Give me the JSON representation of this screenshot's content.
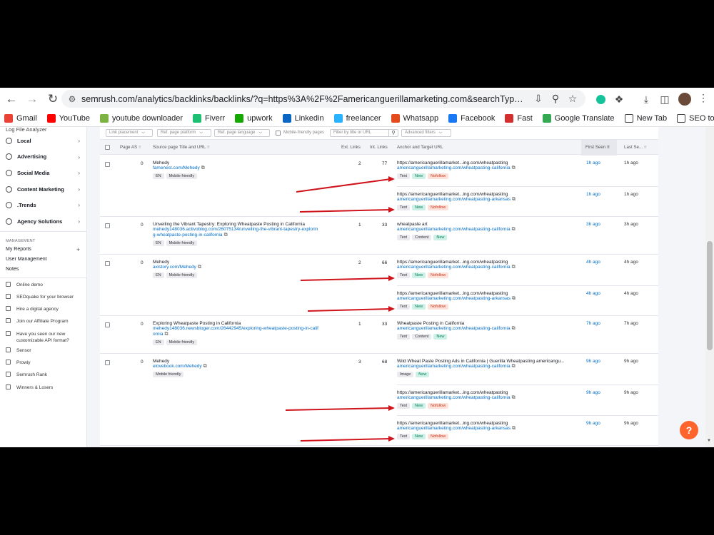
{
  "browser": {
    "url": "semrush.com/analytics/backlinks/backlinks/?q=https%3A%2F%2Famericanguerillamarketing.com&searchType=domain&ba_mt=new&ba...",
    "bookmarks": [
      {
        "label": "Gmail",
        "icon": "gmail-icon",
        "color": "#ea4335"
      },
      {
        "label": "YouTube",
        "icon": "youtube-icon",
        "color": "#ff0000"
      },
      {
        "label": "youtube downloader",
        "icon": "downloader-icon",
        "color": "#7cb342"
      },
      {
        "label": "Fiverr",
        "icon": "fiverr-icon",
        "color": "#1dbf73"
      },
      {
        "label": "upwork",
        "icon": "upwork-icon",
        "color": "#14a800"
      },
      {
        "label": "Linkedin",
        "icon": "linkedin-icon",
        "color": "#0a66c2"
      },
      {
        "label": "freelancer",
        "icon": "freelancer-icon",
        "color": "#29b2fe"
      },
      {
        "label": "Whatsapp",
        "icon": "whatsapp-icon",
        "color": "#e44b1c"
      },
      {
        "label": "Facebook",
        "icon": "facebook-icon",
        "color": "#1877f2"
      },
      {
        "label": "Fast",
        "icon": "speed-icon",
        "color": "#d32f2f"
      },
      {
        "label": "Google Translate",
        "icon": "translate-icon",
        "color": "#34a853"
      },
      {
        "label": "New Tab",
        "icon": "globe-icon",
        "color": "#444444"
      },
      {
        "label": "SEO tools",
        "icon": "folder-icon",
        "color": "#444444"
      }
    ]
  },
  "sidebar": {
    "top_cut": "Log File Analyzer",
    "sections": [
      {
        "label": "Local"
      },
      {
        "label": "Advertising"
      },
      {
        "label": "Social Media"
      },
      {
        "label": "Content Marketing"
      },
      {
        "label": ".Trends"
      },
      {
        "label": "Agency Solutions"
      }
    ],
    "management_caption": "MANAGEMENT",
    "my_reports": "My Reports",
    "plus": "+",
    "user_management": "User Management",
    "notes": "Notes",
    "links": [
      {
        "label": "Online demo"
      },
      {
        "label": "SEOquake for your browser"
      },
      {
        "label": "Hire a digital agency"
      },
      {
        "label": "Join our Affiliate Program"
      },
      {
        "label": "Have you seen our new customizable API format?"
      },
      {
        "label": "Sensor"
      },
      {
        "label": "Prowly"
      },
      {
        "label": "Semrush Rank"
      },
      {
        "label": "Winners & Losers"
      }
    ]
  },
  "filters": {
    "link_placement": "Link placement",
    "ref_page_platform": "Ref. page platform",
    "ref_page_language": "Ref. page language",
    "mobile_friendly": "Mobile-friendly pages",
    "search_placeholder": "Filter by title or URL",
    "advanced": "Advanced filters"
  },
  "table": {
    "headers": {
      "page_as": "Page AS",
      "source": "Source page Title and URL",
      "ext_links": "Ext. Links",
      "int_links": "Int. Links",
      "anchor": "Anchor and Target URL",
      "first_seen": "First Seen",
      "last_seen": "Last Se..."
    },
    "rows": [
      {
        "page_as": "0",
        "title": "Mehedy",
        "url": "famenest.com/Mehedy",
        "tags": [
          "EN",
          "Mobile friendly"
        ],
        "ext": "2",
        "int": "77",
        "anchors": [
          {
            "text": "https://americanguerillamarket...ing.com/wheatpasting",
            "target": "americanguerillamarketing.com/wheatpasting-california",
            "tags": [
              "Text",
              "New",
              "Nofollow"
            ],
            "first": "1h ago",
            "last": "1h ago"
          },
          {
            "text": "https://americanguerillamarket...ing.com/wheatpasting",
            "target": "americanguerillamarketing.com/wheatpasting-arkansas",
            "tags": [
              "Text",
              "New",
              "Nofollow"
            ],
            "first": "1h ago",
            "last": "1h ago"
          }
        ]
      },
      {
        "page_as": "0",
        "title": "Unveiling the Vibrant Tapestry: Exploring Wheatpaste Posting in California",
        "url": "mehedy148036.activoblog.com/26075134/unveiling-the-vibrant-tapestry-explorin",
        "url2": "g-wheatpaste-posting-in-california",
        "tags": [
          "EN",
          "Mobile friendly"
        ],
        "ext": "1",
        "int": "33",
        "anchors": [
          {
            "text": "wheatpaste art",
            "target": "americanguerillamarketing.com/wheatpasting-california",
            "tags": [
              "Text",
              "Content",
              "New"
            ],
            "first": "3h ago",
            "last": "3h ago"
          }
        ]
      },
      {
        "page_as": "0",
        "title": "Mehedy",
        "url": "axistory.com/Mehedy",
        "tags": [
          "EN",
          "Mobile friendly"
        ],
        "ext": "2",
        "int": "66",
        "anchors": [
          {
            "text": "https://americanguerillamarket...ing.com/wheatpasting",
            "target": "americanguerillamarketing.com/wheatpasting-california",
            "tags": [
              "Text",
              "New",
              "Nofollow"
            ],
            "first": "4h ago",
            "last": "4h ago"
          },
          {
            "text": "https://americanguerillamarket...ing.com/wheatpasting",
            "target": "americanguerillamarketing.com/wheatpasting-arkansas",
            "tags": [
              "Text",
              "New",
              "Nofollow"
            ],
            "first": "4h ago",
            "last": "4h ago"
          }
        ]
      },
      {
        "page_as": "0",
        "title": "Exploring Wheatpaste Posting in California",
        "url": "mehedy148036.newsbloger.com/26442945/exploring-wheatpaste-posting-in-calif",
        "url2": "ornia",
        "tags": [
          "EN",
          "Mobile friendly"
        ],
        "ext": "1",
        "int": "33",
        "anchors": [
          {
            "text": "Wheatpaste Posting in California",
            "target": "americanguerillamarketing.com/wheatpasting-california",
            "tags": [
              "Text",
              "Content",
              "New"
            ],
            "first": "7h ago",
            "last": "7h ago"
          }
        ]
      },
      {
        "page_as": "0",
        "title": "Mehedy",
        "url": "elovebook.com/Mehedy",
        "tags": [
          "Mobile friendly"
        ],
        "ext": "3",
        "int": "68",
        "anchors": [
          {
            "text": "Wild Wheat Paste Posting Ads in California | Guerilla Wheatpasting americangu...",
            "target": "americanguerillamarketing.com/wheatpasting-california",
            "tags": [
              "Image",
              "New"
            ],
            "first": "9h ago",
            "last": "9h ago"
          },
          {
            "text": "https://americanguerillamarket...ing.com/wheatpasting",
            "target": "americanguerillamarketing.com/wheatpasting-california",
            "tags": [
              "Text",
              "New",
              "Nofollow"
            ],
            "first": "9h ago",
            "last": "9h ago"
          },
          {
            "text": "https://americanguerillamarket...ing.com/wheatpasting",
            "target": "americanguerillamarketing.com/wheatpasting-arkansas",
            "tags": [
              "Text",
              "New",
              "Nofollow"
            ],
            "first": "9h ago",
            "last": "9h ago"
          }
        ]
      }
    ]
  },
  "help_label": "?",
  "colors": {
    "accent": "#ff642d",
    "link": "#006dca",
    "arrow": "#d0141c"
  }
}
